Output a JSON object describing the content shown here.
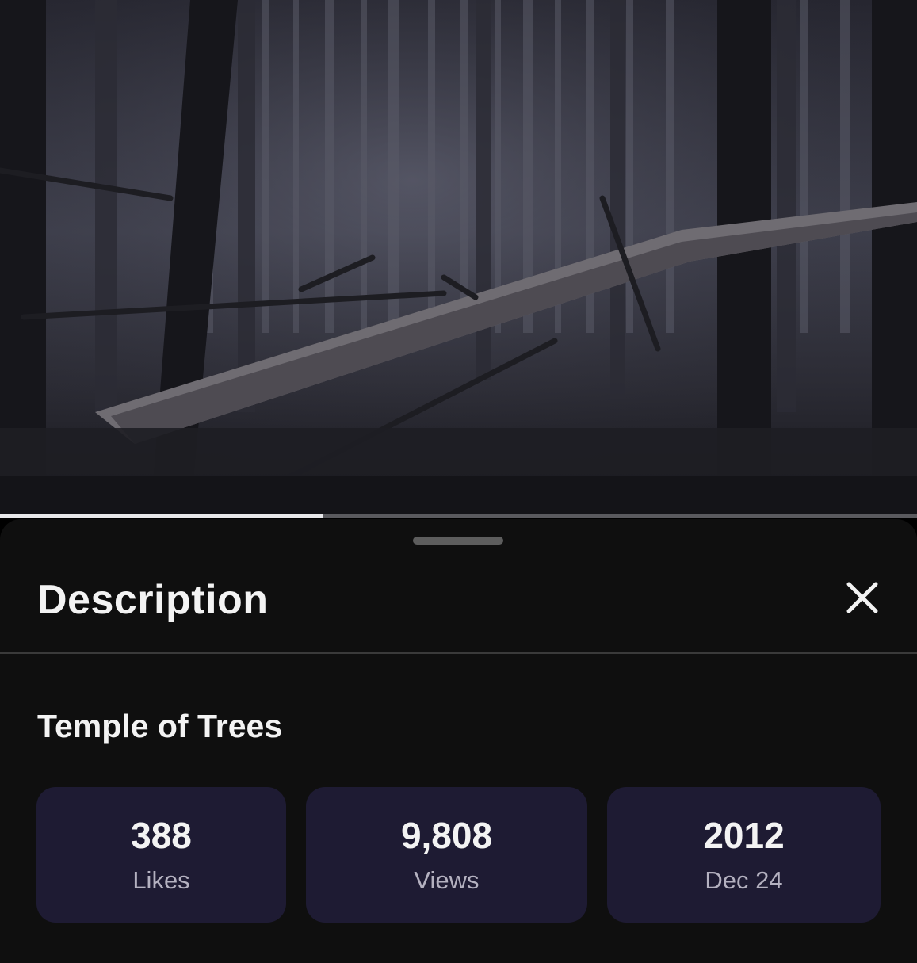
{
  "video": {
    "progress_fraction": 0.353,
    "thumbnail": "dark misty forest with fallen tree trunks"
  },
  "panel": {
    "title": "Description",
    "close_icon": "close-icon"
  },
  "details": {
    "video_title": "Temple of Trees",
    "stats": [
      {
        "value": "388",
        "label": "Likes"
      },
      {
        "value": "9,808",
        "label": "Views"
      },
      {
        "value": "2012",
        "label": "Dec 24"
      }
    ]
  },
  "colors": {
    "sheet_bg": "#0f0f0f",
    "card_bg": "#1e1b33",
    "text_primary": "#f3f3f3",
    "text_secondary": "#b4b1c0"
  }
}
